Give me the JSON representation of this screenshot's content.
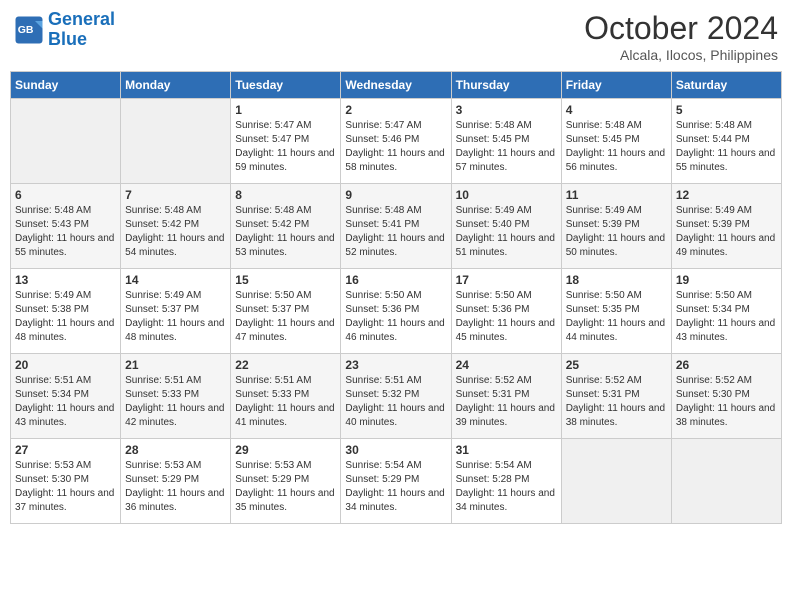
{
  "header": {
    "logo_line1": "General",
    "logo_line2": "Blue",
    "month": "October 2024",
    "location": "Alcala, Ilocos, Philippines"
  },
  "weekdays": [
    "Sunday",
    "Monday",
    "Tuesday",
    "Wednesday",
    "Thursday",
    "Friday",
    "Saturday"
  ],
  "weeks": [
    [
      {
        "day": "",
        "sunrise": "",
        "sunset": "",
        "daylight": ""
      },
      {
        "day": "",
        "sunrise": "",
        "sunset": "",
        "daylight": ""
      },
      {
        "day": "1",
        "sunrise": "Sunrise: 5:47 AM",
        "sunset": "Sunset: 5:47 PM",
        "daylight": "Daylight: 11 hours and 59 minutes."
      },
      {
        "day": "2",
        "sunrise": "Sunrise: 5:47 AM",
        "sunset": "Sunset: 5:46 PM",
        "daylight": "Daylight: 11 hours and 58 minutes."
      },
      {
        "day": "3",
        "sunrise": "Sunrise: 5:48 AM",
        "sunset": "Sunset: 5:45 PM",
        "daylight": "Daylight: 11 hours and 57 minutes."
      },
      {
        "day": "4",
        "sunrise": "Sunrise: 5:48 AM",
        "sunset": "Sunset: 5:45 PM",
        "daylight": "Daylight: 11 hours and 56 minutes."
      },
      {
        "day": "5",
        "sunrise": "Sunrise: 5:48 AM",
        "sunset": "Sunset: 5:44 PM",
        "daylight": "Daylight: 11 hours and 55 minutes."
      }
    ],
    [
      {
        "day": "6",
        "sunrise": "Sunrise: 5:48 AM",
        "sunset": "Sunset: 5:43 PM",
        "daylight": "Daylight: 11 hours and 55 minutes."
      },
      {
        "day": "7",
        "sunrise": "Sunrise: 5:48 AM",
        "sunset": "Sunset: 5:42 PM",
        "daylight": "Daylight: 11 hours and 54 minutes."
      },
      {
        "day": "8",
        "sunrise": "Sunrise: 5:48 AM",
        "sunset": "Sunset: 5:42 PM",
        "daylight": "Daylight: 11 hours and 53 minutes."
      },
      {
        "day": "9",
        "sunrise": "Sunrise: 5:48 AM",
        "sunset": "Sunset: 5:41 PM",
        "daylight": "Daylight: 11 hours and 52 minutes."
      },
      {
        "day": "10",
        "sunrise": "Sunrise: 5:49 AM",
        "sunset": "Sunset: 5:40 PM",
        "daylight": "Daylight: 11 hours and 51 minutes."
      },
      {
        "day": "11",
        "sunrise": "Sunrise: 5:49 AM",
        "sunset": "Sunset: 5:39 PM",
        "daylight": "Daylight: 11 hours and 50 minutes."
      },
      {
        "day": "12",
        "sunrise": "Sunrise: 5:49 AM",
        "sunset": "Sunset: 5:39 PM",
        "daylight": "Daylight: 11 hours and 49 minutes."
      }
    ],
    [
      {
        "day": "13",
        "sunrise": "Sunrise: 5:49 AM",
        "sunset": "Sunset: 5:38 PM",
        "daylight": "Daylight: 11 hours and 48 minutes."
      },
      {
        "day": "14",
        "sunrise": "Sunrise: 5:49 AM",
        "sunset": "Sunset: 5:37 PM",
        "daylight": "Daylight: 11 hours and 48 minutes."
      },
      {
        "day": "15",
        "sunrise": "Sunrise: 5:50 AM",
        "sunset": "Sunset: 5:37 PM",
        "daylight": "Daylight: 11 hours and 47 minutes."
      },
      {
        "day": "16",
        "sunrise": "Sunrise: 5:50 AM",
        "sunset": "Sunset: 5:36 PM",
        "daylight": "Daylight: 11 hours and 46 minutes."
      },
      {
        "day": "17",
        "sunrise": "Sunrise: 5:50 AM",
        "sunset": "Sunset: 5:36 PM",
        "daylight": "Daylight: 11 hours and 45 minutes."
      },
      {
        "day": "18",
        "sunrise": "Sunrise: 5:50 AM",
        "sunset": "Sunset: 5:35 PM",
        "daylight": "Daylight: 11 hours and 44 minutes."
      },
      {
        "day": "19",
        "sunrise": "Sunrise: 5:50 AM",
        "sunset": "Sunset: 5:34 PM",
        "daylight": "Daylight: 11 hours and 43 minutes."
      }
    ],
    [
      {
        "day": "20",
        "sunrise": "Sunrise: 5:51 AM",
        "sunset": "Sunset: 5:34 PM",
        "daylight": "Daylight: 11 hours and 43 minutes."
      },
      {
        "day": "21",
        "sunrise": "Sunrise: 5:51 AM",
        "sunset": "Sunset: 5:33 PM",
        "daylight": "Daylight: 11 hours and 42 minutes."
      },
      {
        "day": "22",
        "sunrise": "Sunrise: 5:51 AM",
        "sunset": "Sunset: 5:33 PM",
        "daylight": "Daylight: 11 hours and 41 minutes."
      },
      {
        "day": "23",
        "sunrise": "Sunrise: 5:51 AM",
        "sunset": "Sunset: 5:32 PM",
        "daylight": "Daylight: 11 hours and 40 minutes."
      },
      {
        "day": "24",
        "sunrise": "Sunrise: 5:52 AM",
        "sunset": "Sunset: 5:31 PM",
        "daylight": "Daylight: 11 hours and 39 minutes."
      },
      {
        "day": "25",
        "sunrise": "Sunrise: 5:52 AM",
        "sunset": "Sunset: 5:31 PM",
        "daylight": "Daylight: 11 hours and 38 minutes."
      },
      {
        "day": "26",
        "sunrise": "Sunrise: 5:52 AM",
        "sunset": "Sunset: 5:30 PM",
        "daylight": "Daylight: 11 hours and 38 minutes."
      }
    ],
    [
      {
        "day": "27",
        "sunrise": "Sunrise: 5:53 AM",
        "sunset": "Sunset: 5:30 PM",
        "daylight": "Daylight: 11 hours and 37 minutes."
      },
      {
        "day": "28",
        "sunrise": "Sunrise: 5:53 AM",
        "sunset": "Sunset: 5:29 PM",
        "daylight": "Daylight: 11 hours and 36 minutes."
      },
      {
        "day": "29",
        "sunrise": "Sunrise: 5:53 AM",
        "sunset": "Sunset: 5:29 PM",
        "daylight": "Daylight: 11 hours and 35 minutes."
      },
      {
        "day": "30",
        "sunrise": "Sunrise: 5:54 AM",
        "sunset": "Sunset: 5:29 PM",
        "daylight": "Daylight: 11 hours and 34 minutes."
      },
      {
        "day": "31",
        "sunrise": "Sunrise: 5:54 AM",
        "sunset": "Sunset: 5:28 PM",
        "daylight": "Daylight: 11 hours and 34 minutes."
      },
      {
        "day": "",
        "sunrise": "",
        "sunset": "",
        "daylight": ""
      },
      {
        "day": "",
        "sunrise": "",
        "sunset": "",
        "daylight": ""
      }
    ]
  ]
}
